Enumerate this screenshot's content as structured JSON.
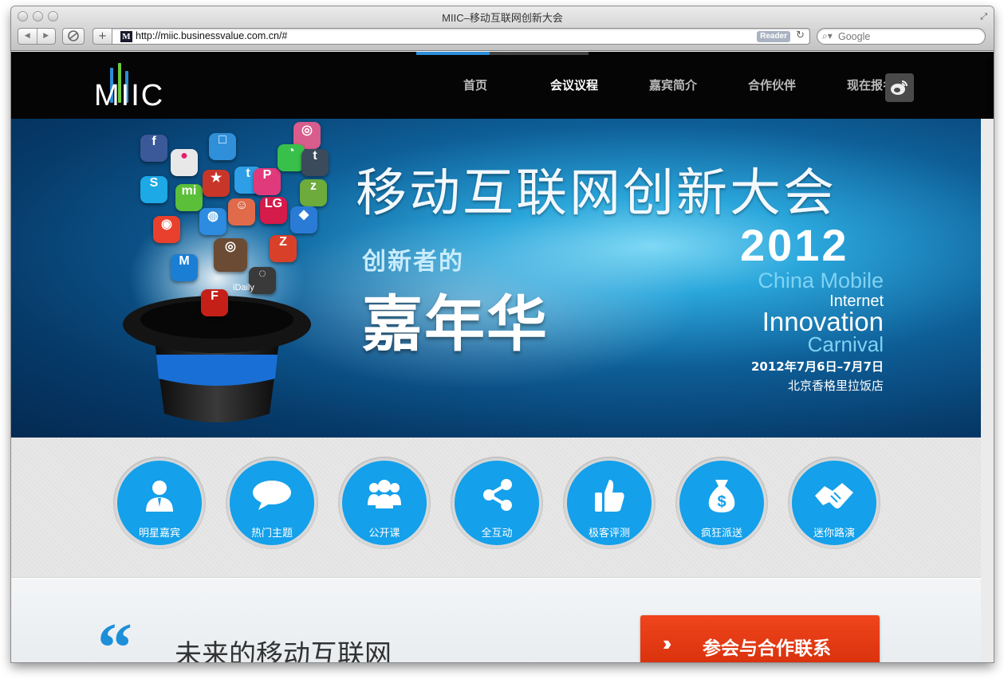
{
  "browser": {
    "window_title": "MIIC–移动互联网创新大会",
    "url": "http://miic.businessvalue.com.cn/#",
    "reader_label": "Reader",
    "search_placeholder": "Google",
    "favicon_letter": "M",
    "new_tab_label": "+"
  },
  "site": {
    "logo_text": "MIIC",
    "nav": [
      {
        "label": "首页"
      },
      {
        "label": "会议议程"
      },
      {
        "label": "嘉宾简介"
      },
      {
        "label": "合作伙伴"
      },
      {
        "label": "现在报名"
      }
    ],
    "active_nav_index": 1
  },
  "banner": {
    "title": "移动互联网创新大会",
    "subtitle_1": "创新者的",
    "subtitle_2": "嘉年华",
    "year": "2012",
    "en_line_1": "China Mobile",
    "en_line_2": "Internet",
    "en_line_3": "Innovation",
    "en_line_4": "Carnival",
    "date": "2012年7月6日–7月7日",
    "venue": "北京香格里拉饭店",
    "hat_label": "iDaily"
  },
  "features": [
    {
      "label": "明星嘉宾",
      "icon": "person-icon"
    },
    {
      "label": "热门主题",
      "icon": "speech-bubble-icon"
    },
    {
      "label": "公开课",
      "icon": "group-icon"
    },
    {
      "label": "全互动",
      "icon": "share-icon"
    },
    {
      "label": "极客评测",
      "icon": "thumbs-up-icon"
    },
    {
      "label": "疯狂派送",
      "icon": "money-bag-icon"
    },
    {
      "label": "迷你路演",
      "icon": "handshake-icon"
    }
  ],
  "content": {
    "quote_mark": "“",
    "section_title": "未来的移动互联网",
    "cta_label": "参会与合作联系",
    "cta_arrow": "››"
  },
  "colors": {
    "accent_blue": "#14a0ea",
    "cta_red": "#e23a12",
    "nav_bg": "#050505"
  }
}
